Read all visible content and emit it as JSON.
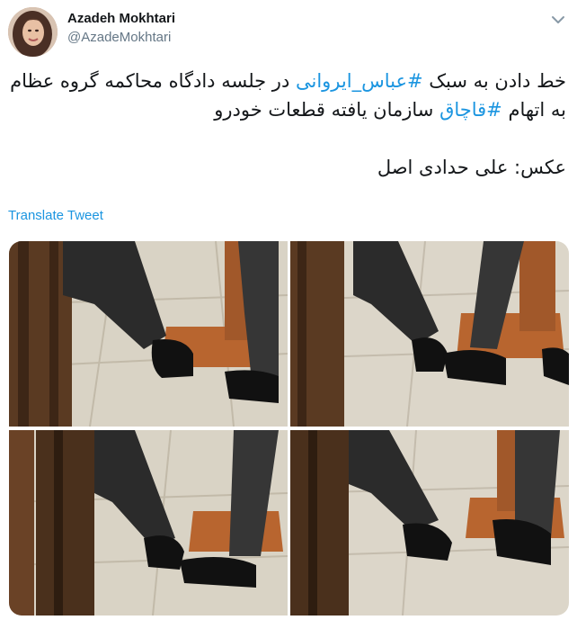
{
  "author": {
    "name": "Azadeh Mokhtari",
    "handle": "@AzadeMokhtari"
  },
  "tweet": {
    "line1": {
      "part1": "خط دادن به سبک ",
      "hashtag1": "#عباس_ایروانی",
      "part2": " در جلسه دادگاه محاکمه گروه عظام"
    },
    "line2": {
      "part1": "به اتهام ",
      "hashtag2": "#قاچاق",
      "part2": " سازمان یافته قطعات خودرو"
    },
    "photo_credit": "عکس: علی حدادی اصل"
  },
  "translate_label": "Translate Tweet",
  "colors": {
    "link": "#1b95e0",
    "text": "#14171a",
    "secondary": "#657786"
  },
  "photos": [
    {
      "name": "photo-1"
    },
    {
      "name": "photo-2"
    },
    {
      "name": "photo-3"
    },
    {
      "name": "photo-4"
    }
  ]
}
